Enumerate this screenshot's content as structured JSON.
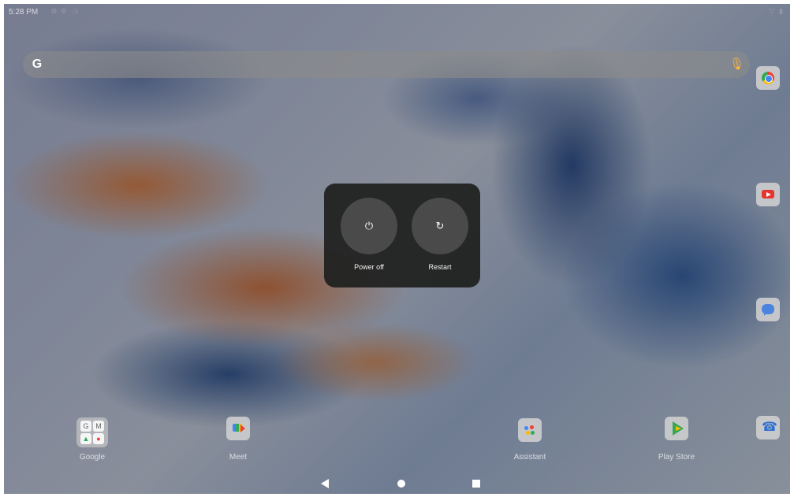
{
  "status_bar": {
    "time": "5:28 PM",
    "left_icons": [
      "settings-icon",
      "gear-icon",
      "clock-icon"
    ],
    "right_icons": [
      "wifi-icon",
      "battery-icon"
    ]
  },
  "search_bar": {
    "logo": "G",
    "mic_icon": "mic-icon"
  },
  "side_apps": [
    {
      "name": "Chrome",
      "icon": "chrome-icon"
    },
    {
      "name": "YouTube",
      "icon": "youtube-icon"
    },
    {
      "name": "Messages",
      "icon": "messages-icon"
    },
    {
      "name": "Phone",
      "icon": "phone-icon"
    }
  ],
  "dock": {
    "items": [
      {
        "label": "Google",
        "icon": "google-folder-icon"
      },
      {
        "label": "Meet",
        "icon": "meet-icon"
      },
      {
        "label": "Assistant",
        "icon": "assistant-icon"
      },
      {
        "label": "Play Store",
        "icon": "play-store-icon"
      }
    ]
  },
  "power_menu": {
    "power_off_label": "Power off",
    "restart_label": "Restart",
    "power_icon": "power-icon",
    "restart_icon": "restart-icon"
  },
  "navigation": {
    "back_icon": "back-icon",
    "home_icon": "home-icon",
    "recents_icon": "recents-icon"
  },
  "colors": {
    "dim_overlay": "rgba(0,0,0,0.37)",
    "power_panel": "#202120",
    "power_button": "#4a4a4a",
    "google_mic": "#ffb43c"
  }
}
